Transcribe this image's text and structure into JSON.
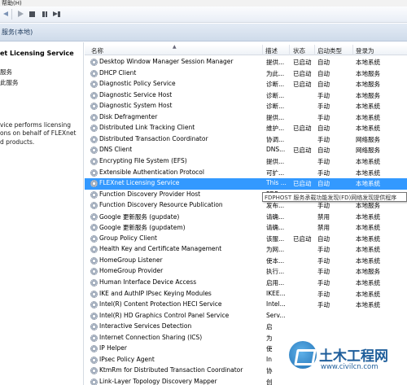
{
  "menu": {
    "help_label": "帮助(H)"
  },
  "header": {
    "title": "服务(本地)"
  },
  "details": {
    "service_title": "et Licensing Service",
    "lines": [
      "服务",
      "此服务",
      "",
      "vice performs licensing",
      "ons on behalf of FLEXnet",
      "d products."
    ]
  },
  "columns": {
    "name": "名称",
    "description": "描述",
    "status": "状态",
    "startup": "启动类型",
    "logon": "登录为"
  },
  "services": [
    {
      "name": "Desktop Window Manager Session Manager",
      "description": "提供...",
      "status": "已启动",
      "startup": "自动",
      "logon": "本地系统"
    },
    {
      "name": "DHCP Client",
      "description": "为此...",
      "status": "已启动",
      "startup": "自动",
      "logon": "本地服务"
    },
    {
      "name": "Diagnostic Policy Service",
      "description": "诊断...",
      "status": "已启动",
      "startup": "自动",
      "logon": "本地服务"
    },
    {
      "name": "Diagnostic Service Host",
      "description": "诊断...",
      "status": "",
      "startup": "手动",
      "logon": "本地服务"
    },
    {
      "name": "Diagnostic System Host",
      "description": "诊断...",
      "status": "",
      "startup": "手动",
      "logon": "本地系统"
    },
    {
      "name": "Disk Defragmenter",
      "description": "提供...",
      "status": "",
      "startup": "手动",
      "logon": "本地系统"
    },
    {
      "name": "Distributed Link Tracking Client",
      "description": "维护...",
      "status": "已启动",
      "startup": "自动",
      "logon": "本地系统"
    },
    {
      "name": "Distributed Transaction Coordinator",
      "description": "协调...",
      "status": "",
      "startup": "手动",
      "logon": "网络服务"
    },
    {
      "name": "DNS Client",
      "description": "DNS...",
      "status": "已启动",
      "startup": "自动",
      "logon": "网络服务"
    },
    {
      "name": "Encrypting File System (EFS)",
      "description": "提供...",
      "status": "",
      "startup": "手动",
      "logon": "本地系统"
    },
    {
      "name": "Extensible Authentication Protocol",
      "description": "可扩...",
      "status": "",
      "startup": "手动",
      "logon": "本地系统"
    },
    {
      "name": "FLEXnet Licensing Service",
      "description": "This ...",
      "status": "已启动",
      "startup": "自动",
      "logon": "本地系统"
    },
    {
      "name": "Function Discovery Provider Host",
      "description": "FDP...",
      "status": "",
      "startup": "",
      "logon": ""
    },
    {
      "name": "Function Discovery Resource Publication",
      "description": "发布...",
      "status": "",
      "startup": "手动",
      "logon": "本地服务"
    },
    {
      "name": "Google 更新服务 (gupdate)",
      "description": "请确...",
      "status": "",
      "startup": "禁用",
      "logon": "本地系统"
    },
    {
      "name": "Google 更新服务 (gupdatem)",
      "description": "请确...",
      "status": "",
      "startup": "禁用",
      "logon": "本地系统"
    },
    {
      "name": "Group Policy Client",
      "description": "该服...",
      "status": "已启动",
      "startup": "自动",
      "logon": "本地系统"
    },
    {
      "name": "Health Key and Certificate Management",
      "description": "为网...",
      "status": "",
      "startup": "手动",
      "logon": "本地系统"
    },
    {
      "name": "HomeGroup Listener",
      "description": "使本...",
      "status": "",
      "startup": "手动",
      "logon": "本地系统"
    },
    {
      "name": "HomeGroup Provider",
      "description": "执行...",
      "status": "",
      "startup": "手动",
      "logon": "本地服务"
    },
    {
      "name": "Human Interface Device Access",
      "description": "启用...",
      "status": "",
      "startup": "手动",
      "logon": "本地系统"
    },
    {
      "name": "IKE and AuthIP IPsec Keying Modules",
      "description": "IKEE...",
      "status": "",
      "startup": "手动",
      "logon": "本地系统"
    },
    {
      "name": "Intel(R) Content Protection HECI Service",
      "description": "Intel...",
      "status": "",
      "startup": "手动",
      "logon": "本地系统"
    },
    {
      "name": "Intel(R) HD Graphics Control Panel Service",
      "description": "Serv...",
      "status": "",
      "startup": "",
      "logon": ""
    },
    {
      "name": "Interactive Services Detection",
      "description": "启",
      "status": "",
      "startup": "",
      "logon": ""
    },
    {
      "name": "Internet Connection Sharing (ICS)",
      "description": "为",
      "status": "",
      "startup": "",
      "logon": ""
    },
    {
      "name": "IP Helper",
      "description": "使",
      "status": "",
      "startup": "",
      "logon": ""
    },
    {
      "name": "IPsec Policy Agent",
      "description": "In",
      "status": "",
      "startup": "",
      "logon": ""
    },
    {
      "name": "KtmRm for Distributed Transaction Coordinator",
      "description": "协",
      "status": "",
      "startup": "",
      "logon": ""
    },
    {
      "name": "Link-Layer Topology Discovery Mapper",
      "description": "创",
      "status": "",
      "startup": "",
      "logon": ""
    }
  ],
  "selected_index": 11,
  "tooltip": "FDPHOST 服务承载功能发现(FD)网络发现提供程序",
  "watermark": {
    "brand": "土木工程网",
    "url": "www.civilcn.com"
  },
  "colors": {
    "selection": "#3399ff",
    "header_band": "#dbe5f1"
  }
}
